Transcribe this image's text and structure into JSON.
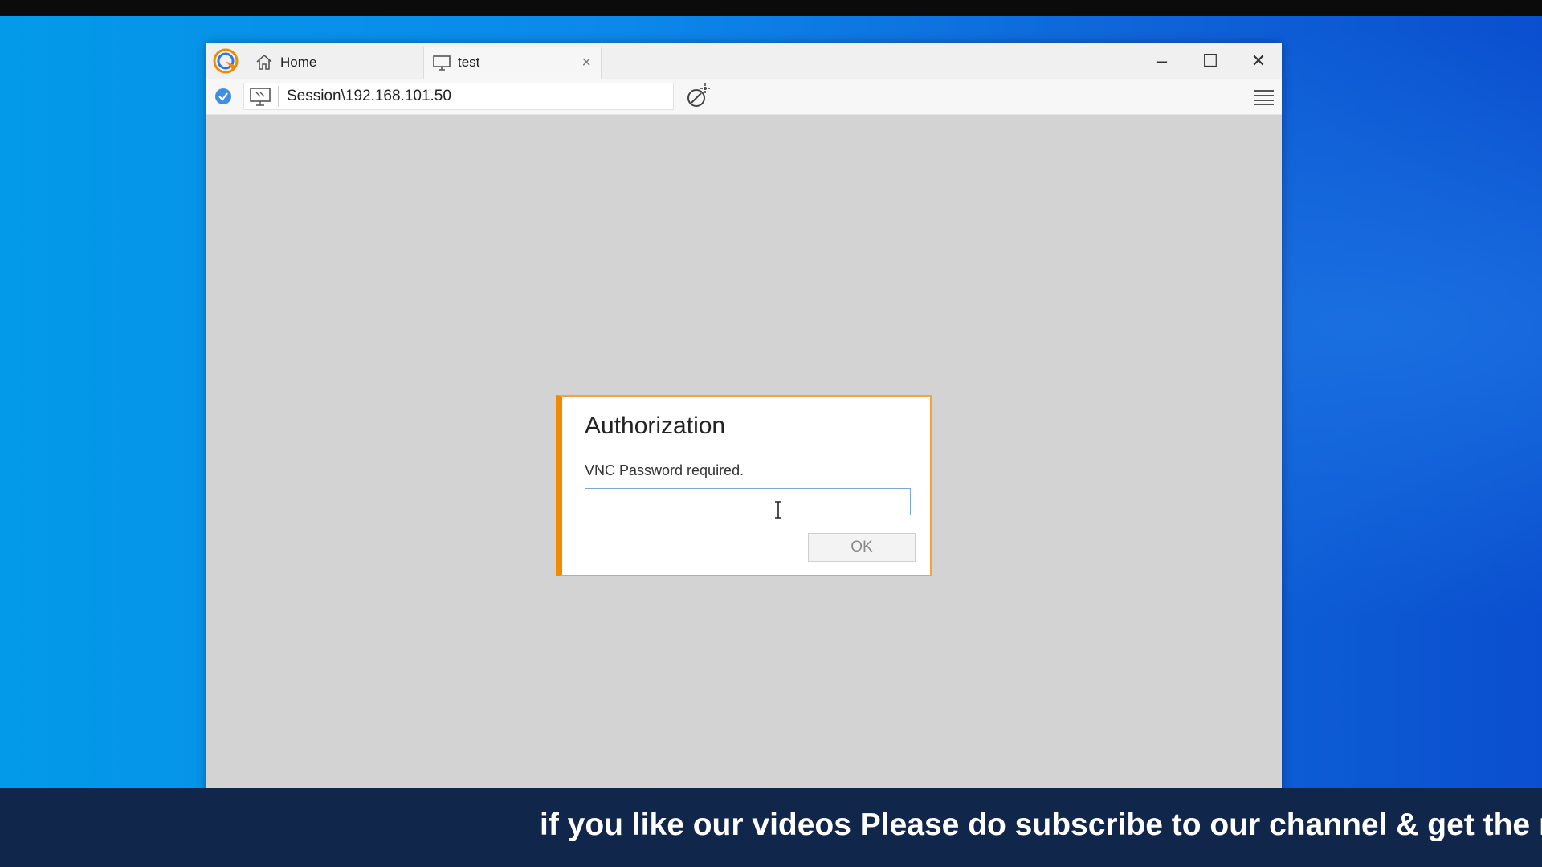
{
  "tabs": [
    {
      "label": "Home",
      "icon": "home-icon"
    },
    {
      "label": "test",
      "icon": "monitor-icon",
      "close": "×"
    }
  ],
  "window_controls": {
    "minimize": "–",
    "maximize": "☐",
    "close": "✕"
  },
  "toolbar": {
    "address": "Session\\192.168.101.50"
  },
  "dialog": {
    "title": "Authorization",
    "message": "VNC Password required.",
    "password_value": "",
    "ok_label": "OK"
  },
  "banner": {
    "text": "if you like our videos Please do subscribe to our channel & get the no"
  },
  "colors": {
    "dialog_accent": "#f08a00",
    "banner_bg": "#10264a",
    "desktop_blue": "#0c88ea"
  }
}
